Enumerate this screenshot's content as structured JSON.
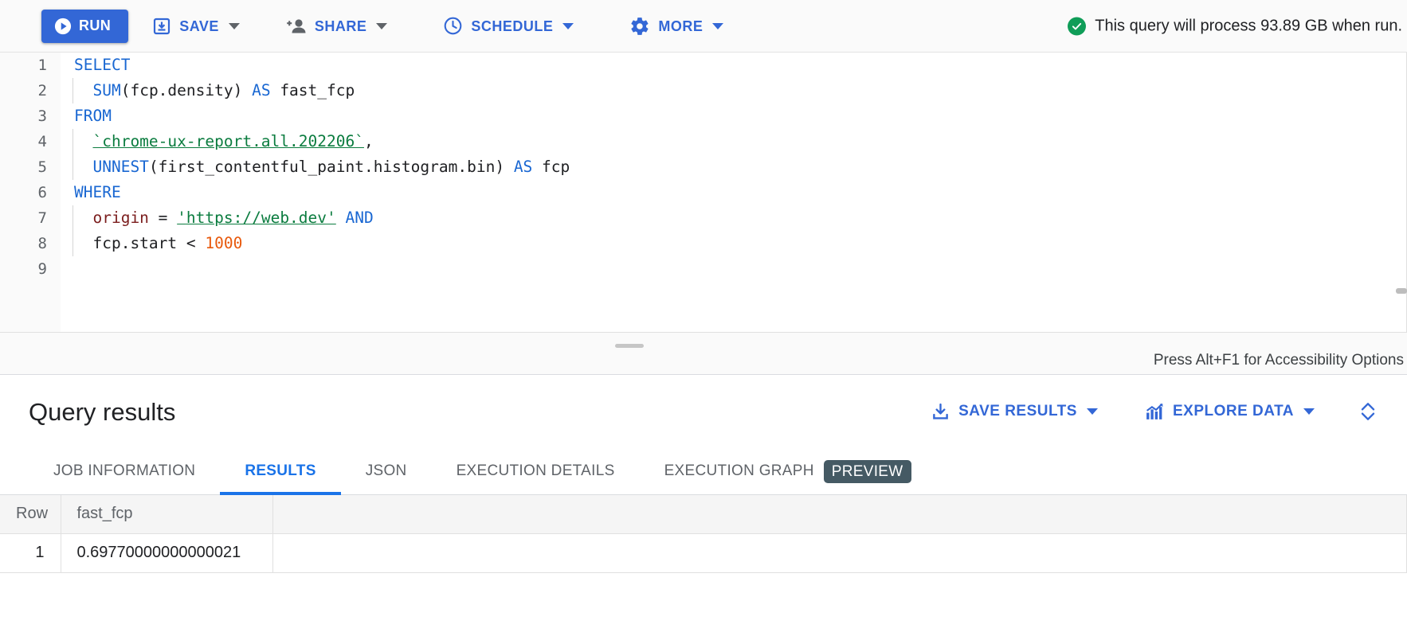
{
  "toolbar": {
    "run_label": "RUN",
    "save_label": "SAVE",
    "share_label": "SHARE",
    "schedule_label": "SCHEDULE",
    "more_label": "MORE",
    "quota_text": "This query will process 93.89 GB when run.",
    "run_bg": "#3367d6",
    "accent": "#3367d6",
    "success_color": "#0f9d58"
  },
  "editor": {
    "line_numbers": [
      "1",
      "2",
      "3",
      "4",
      "5",
      "6",
      "7",
      "8",
      "9"
    ],
    "lines": [
      {
        "n": "1",
        "indent": false,
        "tokens": [
          {
            "t": "SELECT",
            "c": "kw"
          }
        ]
      },
      {
        "n": "2",
        "indent": true,
        "tokens": [
          {
            "t": "  ",
            "c": "plain"
          },
          {
            "t": "SUM",
            "c": "kw"
          },
          {
            "t": "(fcp.density) ",
            "c": "plain"
          },
          {
            "t": "AS",
            "c": "kw"
          },
          {
            "t": " fast_fcp",
            "c": "plain"
          }
        ]
      },
      {
        "n": "3",
        "indent": false,
        "tokens": [
          {
            "t": "FROM",
            "c": "kw"
          }
        ]
      },
      {
        "n": "4",
        "indent": true,
        "tokens": [
          {
            "t": "  ",
            "c": "plain"
          },
          {
            "t": "`chrome-ux-report.all.202206`",
            "c": "tbl"
          },
          {
            "t": ",",
            "c": "punct"
          }
        ]
      },
      {
        "n": "5",
        "indent": true,
        "tokens": [
          {
            "t": "  ",
            "c": "plain"
          },
          {
            "t": "UNNEST",
            "c": "kw"
          },
          {
            "t": "(first_contentful_paint.histogram.bin) ",
            "c": "plain"
          },
          {
            "t": "AS",
            "c": "kw"
          },
          {
            "t": " fcp",
            "c": "plain"
          }
        ]
      },
      {
        "n": "6",
        "indent": false,
        "tokens": [
          {
            "t": "WHERE",
            "c": "kw"
          }
        ]
      },
      {
        "n": "7",
        "indent": true,
        "tokens": [
          {
            "t": "  ",
            "c": "plain"
          },
          {
            "t": "origin",
            "c": "id"
          },
          {
            "t": " = ",
            "c": "punct"
          },
          {
            "t": "'",
            "c": "str"
          },
          {
            "t": "https://web.dev",
            "c": "str"
          },
          {
            "t": "'",
            "c": "str"
          },
          {
            "t": " ",
            "c": "plain"
          },
          {
            "t": "AND",
            "c": "kw"
          }
        ]
      },
      {
        "n": "8",
        "indent": true,
        "tokens": [
          {
            "t": "  fcp.start ",
            "c": "plain"
          },
          {
            "t": "< ",
            "c": "punct"
          },
          {
            "t": "1000",
            "c": "num"
          }
        ]
      },
      {
        "n": "9",
        "indent": false,
        "tokens": []
      }
    ],
    "raw_sql": "SELECT\n  SUM(fcp.density) AS fast_fcp\nFROM\n  `chrome-ux-report.all.202206`,\n  UNNEST(first_contentful_paint.histogram.bin) AS fcp\nWHERE\n  origin = 'https://web.dev' AND\n  fcp.start < 1000\n",
    "accessibility_hint": "Press Alt+F1 for Accessibility Options"
  },
  "results": {
    "title": "Query results",
    "save_results_label": "SAVE RESULTS",
    "explore_data_label": "EXPLORE DATA",
    "tabs": [
      {
        "label": "JOB INFORMATION",
        "active": false,
        "badge": ""
      },
      {
        "label": "RESULTS",
        "active": true,
        "badge": ""
      },
      {
        "label": "JSON",
        "active": false,
        "badge": ""
      },
      {
        "label": "EXECUTION DETAILS",
        "active": false,
        "badge": ""
      },
      {
        "label": "EXECUTION GRAPH",
        "active": false,
        "badge": "PREVIEW"
      }
    ],
    "table": {
      "columns": [
        "Row",
        "fast_fcp"
      ],
      "rows": [
        {
          "row": "1",
          "fast_fcp": "0.69770000000000021"
        }
      ]
    },
    "active_tab_color": "#1a73e8",
    "preview_badge_bg": "#455a64"
  }
}
